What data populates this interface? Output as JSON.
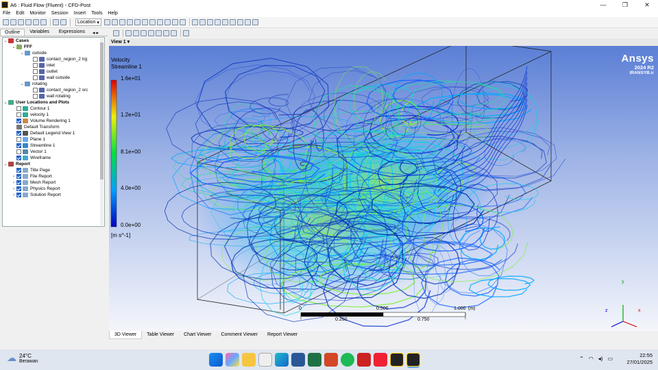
{
  "window": {
    "title": "A6 : Fluid Flow (Fluent) - CFD-Post",
    "controls": [
      "—",
      "❐",
      "✕"
    ]
  },
  "menu": [
    "File",
    "Edit",
    "Monitor",
    "Session",
    "Insert",
    "Tools",
    "Help"
  ],
  "toolbar": {
    "location_label": "Location"
  },
  "left_tabs": [
    "Outline",
    "Variables",
    "Expressions"
  ],
  "tree": [
    {
      "indent": 0,
      "tw": "⌄",
      "check": null,
      "icon": "#c33",
      "label": "Cases",
      "bold": true
    },
    {
      "indent": 1,
      "tw": "⌄",
      "check": null,
      "icon": "#8a6",
      "label": "FFF",
      "bold": true
    },
    {
      "indent": 2,
      "tw": "⌄",
      "check": null,
      "icon": "#69c",
      "label": "outside"
    },
    {
      "indent": 3,
      "tw": "",
      "check": false,
      "icon": "#56a",
      "label": "contact_region_2 trg"
    },
    {
      "indent": 3,
      "tw": "",
      "check": false,
      "icon": "#56a",
      "label": "inlet"
    },
    {
      "indent": 3,
      "tw": "",
      "check": false,
      "icon": "#56a",
      "label": "outlet"
    },
    {
      "indent": 3,
      "tw": "",
      "check": false,
      "icon": "#56a",
      "label": "wall outside"
    },
    {
      "indent": 2,
      "tw": "⌄",
      "check": null,
      "icon": "#69c",
      "label": "rotating"
    },
    {
      "indent": 3,
      "tw": "",
      "check": false,
      "icon": "#56a",
      "label": "contact_region_2 src"
    },
    {
      "indent": 3,
      "tw": "",
      "check": false,
      "icon": "#56a",
      "label": "wall rotating"
    },
    {
      "indent": 0,
      "tw": "⌄",
      "check": null,
      "icon": "#4a8",
      "label": "User Locations and Plots",
      "bold": true
    },
    {
      "indent": 1,
      "tw": "",
      "check": false,
      "icon": "#3a9",
      "label": "Contour 1"
    },
    {
      "indent": 1,
      "tw": "",
      "check": false,
      "icon": "#3a9",
      "label": "velocity 1"
    },
    {
      "indent": 1,
      "tw": "",
      "check": true,
      "icon": "#c84",
      "label": "Volume Rendering 1"
    },
    {
      "indent": 1,
      "tw": "",
      "check": null,
      "icon": "#777",
      "label": "Default Transform"
    },
    {
      "indent": 1,
      "tw": "",
      "check": true,
      "icon": "#555",
      "label": "Default Legend View 1"
    },
    {
      "indent": 1,
      "tw": "",
      "check": false,
      "icon": "#6ae",
      "label": "Plane 1"
    },
    {
      "indent": 1,
      "tw": "",
      "check": true,
      "icon": "#38c",
      "label": "Streamline 1"
    },
    {
      "indent": 1,
      "tw": "",
      "check": false,
      "icon": "#58a",
      "label": "Vector 1"
    },
    {
      "indent": 1,
      "tw": "",
      "check": true,
      "icon": "#4ac",
      "label": "Wireframe"
    },
    {
      "indent": 0,
      "tw": "⌄",
      "check": null,
      "icon": "#a44",
      "label": "Report",
      "bold": true
    },
    {
      "indent": 1,
      "tw": "",
      "check": true,
      "icon": "#8ac",
      "label": "Title Page"
    },
    {
      "indent": 1,
      "tw": "›",
      "check": true,
      "icon": "#8ac",
      "label": "File Report"
    },
    {
      "indent": 1,
      "tw": "›",
      "check": true,
      "icon": "#8ac",
      "label": "Mesh Report"
    },
    {
      "indent": 1,
      "tw": "›",
      "check": true,
      "icon": "#8ac",
      "label": "Physics Report"
    },
    {
      "indent": 1,
      "tw": "›",
      "check": true,
      "icon": "#8ac",
      "label": "Solution Report"
    }
  ],
  "viewer": {
    "view_label": "View 1",
    "legend": {
      "var": "Velocity",
      "obj": "Streamline 1",
      "ticks": [
        "1.6e+01",
        "1.2e+01",
        "8.1e+00",
        "4.0e+00",
        "0.0e+00"
      ],
      "unit": "[m s^-1]"
    },
    "brand": {
      "name": "Ansys",
      "version": "2024 R2",
      "site": "IRANSYB.ir"
    },
    "scale": {
      "top": [
        "0",
        "0.500",
        "1.000",
        "(m)"
      ],
      "bottom": [
        "0.250",
        "0.750"
      ]
    },
    "axes": {
      "x": "x",
      "y": "y",
      "z": "z"
    }
  },
  "viewer_tabs": [
    "3D Viewer",
    "Table Viewer",
    "Chart Viewer",
    "Comment Viewer",
    "Report Viewer"
  ],
  "taskbar": {
    "temp": "24°C",
    "weather": "Berawan",
    "time": "22:55",
    "date": "27/01/2025"
  }
}
